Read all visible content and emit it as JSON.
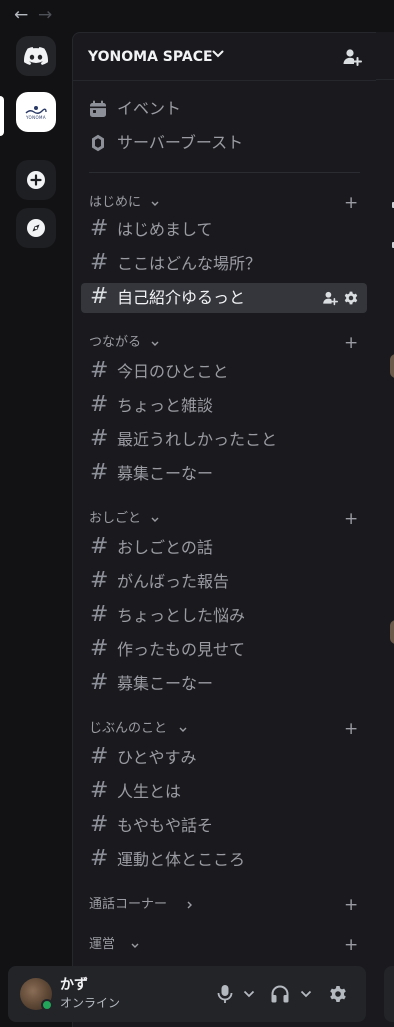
{
  "colors": {
    "app_bg": "#121214",
    "sidebar_bg": "#1a1a1e",
    "active_row": "#35363c",
    "online": "#23a55a",
    "text_muted": "#9b9ca3",
    "text_bright": "#f2f3f5"
  },
  "nav": {
    "back_icon": "arrow-left-icon",
    "forward_icon": "arrow-right-icon"
  },
  "rail": {
    "home_icon": "discord-logo-icon",
    "server_logo_text": "YONOMA",
    "add_icon": "plus-circle-icon",
    "explore_icon": "compass-icon"
  },
  "server": {
    "name": "YONOMA SPACE",
    "header_icon": "chevron-down-icon",
    "invite_icon": "add-member-icon"
  },
  "top_items": [
    {
      "label": "イベント",
      "icon": "calendar-icon"
    },
    {
      "label": "サーバーブースト",
      "icon": "boost-gem-icon"
    }
  ],
  "categories": [
    {
      "name": "はじめに",
      "collapsed": false,
      "channels": [
        {
          "name": "はじめまして",
          "active": false
        },
        {
          "name": "ここはどんな場所？",
          "active": false
        },
        {
          "name": "自己紹介ゆるっと",
          "active": true
        }
      ]
    },
    {
      "name": "つながる",
      "collapsed": false,
      "channels": [
        {
          "name": "今日のひとこと",
          "active": false
        },
        {
          "name": "ちょっと雑談",
          "active": false
        },
        {
          "name": "最近うれしかったこと",
          "active": false
        },
        {
          "name": "募集こーなー",
          "active": false
        }
      ]
    },
    {
      "name": "おしごと",
      "collapsed": false,
      "channels": [
        {
          "name": "おしごとの話",
          "active": false
        },
        {
          "name": "がんばった報告",
          "active": false
        },
        {
          "name": "ちょっとした悩み",
          "active": false
        },
        {
          "name": "作ったもの見せて",
          "active": false
        },
        {
          "name": "募集こーなー",
          "active": false
        }
      ]
    },
    {
      "name": "じぶんのこと",
      "collapsed": false,
      "channels": [
        {
          "name": "ひとやすみ",
          "active": false
        },
        {
          "name": "人生とは",
          "active": false
        },
        {
          "name": "もやもや話そ",
          "active": false
        },
        {
          "name": "運動と体とこころ",
          "active": false
        }
      ]
    },
    {
      "name": "通話コーナー",
      "collapsed": true,
      "channels": []
    },
    {
      "name": "運営",
      "collapsed": false,
      "channels": []
    }
  ],
  "user": {
    "name": "かず",
    "status": "オンライン",
    "mic_icon": "microphone-icon",
    "headset_icon": "headphones-icon",
    "settings_icon": "gear-icon"
  }
}
